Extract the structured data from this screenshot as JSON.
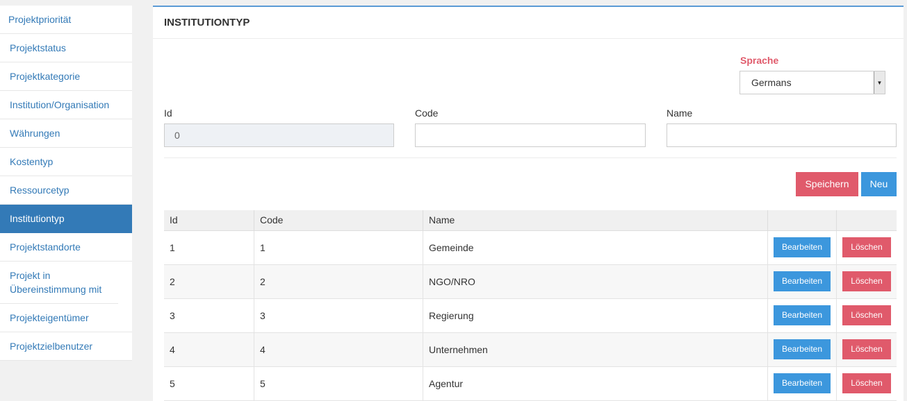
{
  "sidebar": {
    "items": [
      {
        "label": "Projektpriorität"
      },
      {
        "label": "Projektstatus"
      },
      {
        "label": "Projektkategorie"
      },
      {
        "label": "Institution/Organisation"
      },
      {
        "label": "Währungen"
      },
      {
        "label": "Kostentyp"
      },
      {
        "label": "Ressourcetyp"
      },
      {
        "label": "Institutiontyp"
      },
      {
        "label": "Projektstandorte"
      },
      {
        "label": "Projekt in Übereinstimmung mit"
      },
      {
        "label": "Projekteigentümer"
      },
      {
        "label": "Projektzielbenutzer"
      }
    ],
    "active_index": 7
  },
  "panel": {
    "title": "INSTITUTIONTYP",
    "language": {
      "label": "Sprache",
      "value": "Germans"
    },
    "form": {
      "id_label": "Id",
      "id_value": "0",
      "code_label": "Code",
      "code_value": "",
      "name_label": "Name",
      "name_value": ""
    },
    "save_label": "Speichern",
    "new_label": "Neu"
  },
  "table": {
    "headers": [
      "Id",
      "Code",
      "Name",
      "",
      ""
    ],
    "edit_label": "Bearbeiten",
    "delete_label": "Löschen",
    "rows": [
      {
        "id": "1",
        "code": "1",
        "name": "Gemeinde"
      },
      {
        "id": "2",
        "code": "2",
        "name": "NGO/NRO"
      },
      {
        "id": "3",
        "code": "3",
        "name": "Regierung"
      },
      {
        "id": "4",
        "code": "4",
        "name": "Unternehmen"
      },
      {
        "id": "5",
        "code": "5",
        "name": "Agentur"
      }
    ]
  },
  "colors": {
    "primary": "#337ab7",
    "danger": "#e05a6b",
    "info": "#3c97dd"
  }
}
